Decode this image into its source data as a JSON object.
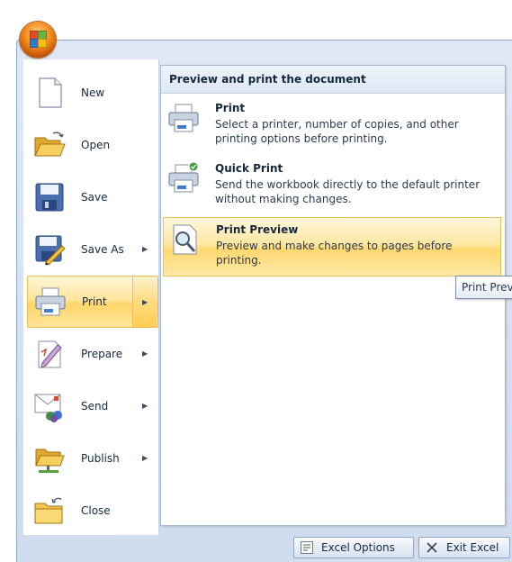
{
  "file_menu": {
    "items": [
      {
        "label": "New",
        "icon": "new-document-icon",
        "has_submenu": false
      },
      {
        "label": "Open",
        "icon": "open-folder-icon",
        "has_submenu": false
      },
      {
        "label": "Save",
        "icon": "save-disk-icon",
        "has_submenu": false
      },
      {
        "label": "Save As",
        "icon": "save-as-icon",
        "has_submenu": true
      },
      {
        "label": "Print",
        "icon": "printer-icon",
        "has_submenu": true,
        "active": true
      },
      {
        "label": "Prepare",
        "icon": "prepare-pen-icon",
        "has_submenu": true
      },
      {
        "label": "Send",
        "icon": "send-icon",
        "has_submenu": true
      },
      {
        "label": "Publish",
        "icon": "publish-icon",
        "has_submenu": true
      },
      {
        "label": "Close",
        "icon": "close-folder-icon",
        "has_submenu": false
      }
    ]
  },
  "submenu": {
    "header": "Preview and print the document",
    "items": [
      {
        "title": "Print",
        "description": "Select a printer, number of copies, and other printing options before printing."
      },
      {
        "title": "Quick Print",
        "description": "Send the workbook directly to the default printer without making changes."
      },
      {
        "title": "Print Preview",
        "description": "Preview and make changes to pages before printing.",
        "highlighted": true
      }
    ]
  },
  "tooltip": {
    "text": "Print Preview"
  },
  "footer": {
    "options_label": "Excel Options",
    "exit_label": "Exit Excel"
  },
  "colors": {
    "highlight": "#ffd66b",
    "frame": "#dfe9f5",
    "border": "#8ea7c9"
  }
}
